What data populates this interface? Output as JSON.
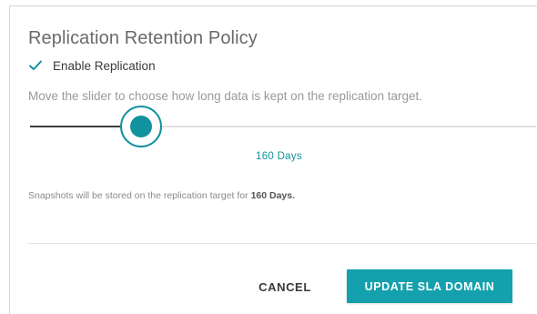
{
  "dialog": {
    "title": "Replication Retention Policy",
    "enable_replication": {
      "label": "Enable Replication",
      "checked": true,
      "icon": "checkmark-icon"
    },
    "instruction": "Move the slider to choose how long data is kept on the replication target.",
    "slider": {
      "value_label": "160 Days",
      "fraction": 0.22
    },
    "summary": {
      "prefix": "Snapshots will be stored on the replication target for ",
      "value": "160 Days.",
      "suffix": ""
    },
    "buttons": {
      "cancel": "CANCEL",
      "update": "UPDATE SLA DOMAIN"
    }
  },
  "colors": {
    "accent": "#12929e",
    "button_primary": "#14a1ad",
    "track": "#e0e0e0",
    "track_fill": "#3d3d3d"
  }
}
